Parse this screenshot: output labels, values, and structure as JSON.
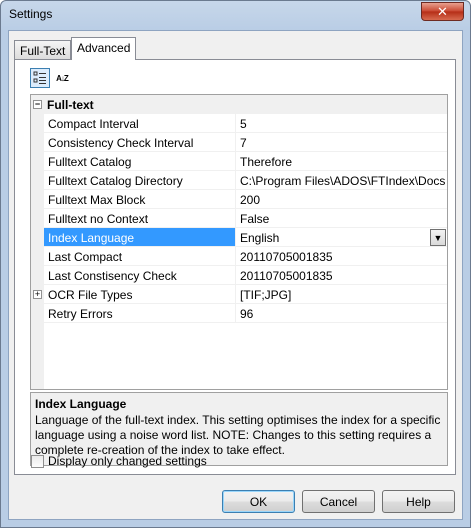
{
  "window": {
    "title": "Settings",
    "close_glyph": "✕"
  },
  "tabs": [
    {
      "label": "Full-Text",
      "active": false
    },
    {
      "label": "Advanced",
      "active": true
    }
  ],
  "toolbar": {
    "categorized_icon": "categorized-icon",
    "alphabetical_icon": "sort-alphabetical-icon",
    "alphabetical_glyph": "A↓Z"
  },
  "grid": {
    "category": {
      "label": "Full-text",
      "expander": "−"
    },
    "rows": [
      {
        "name": "Compact Interval",
        "value": "5"
      },
      {
        "name": "Consistency Check Interval",
        "value": "7"
      },
      {
        "name": "Fulltext Catalog",
        "value": "Therefore"
      },
      {
        "name": "Fulltext Catalog Directory",
        "value": "C:\\Program Files\\ADOS\\FTIndex\\Docs"
      },
      {
        "name": "Fulltext Max Block",
        "value": "200"
      },
      {
        "name": "Fulltext no Context",
        "value": "False"
      },
      {
        "name": "Index Language",
        "value": "English",
        "selected": true
      },
      {
        "name": "Last Compact",
        "value": "20110705001835"
      },
      {
        "name": "Last Constisency Check",
        "value": "20110705001835"
      },
      {
        "name": "OCR File Types",
        "value": "[TIF;JPG]",
        "expander": "+"
      },
      {
        "name": "Retry Errors",
        "value": "96"
      }
    ]
  },
  "description": {
    "title": "Index Language",
    "text": "Language of the full-text index. This setting optimises the index for a specific language using a noise word list. NOTE: Changes to this setting requires a complete re-creation of the index to take effect."
  },
  "checkbox": {
    "label": "Display only changed settings",
    "checked": false
  },
  "buttons": {
    "ok": "OK",
    "cancel": "Cancel",
    "help": "Help"
  },
  "colors": {
    "selection": "#3399ff",
    "frame": "#b9cde5",
    "close": "#c8452e"
  }
}
